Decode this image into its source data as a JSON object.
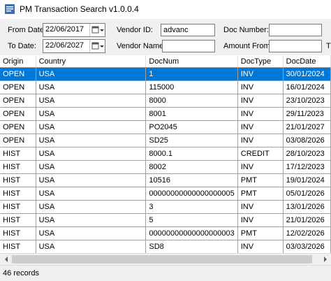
{
  "window": {
    "title": "PM Transaction Search v1.0.0.4"
  },
  "filters": {
    "from_date_label": "From Date:",
    "from_date_value": "22/06/2017",
    "to_date_label": "To Date:",
    "to_date_value": "22/06/2027",
    "vendor_id_label": "Vendor ID:",
    "vendor_id_value": "advanc",
    "vendor_name_label": "Vendor Name:",
    "vendor_name_value": "",
    "doc_number_label": "Doc Number:",
    "doc_number_value": "",
    "amount_from_label": "Amount From:",
    "amount_from_value": "",
    "amount_to_label_partial": "T"
  },
  "grid": {
    "columns": [
      "Origin",
      "Country",
      "DocNum",
      "DocType",
      "DocDate"
    ],
    "rows": [
      [
        "OPEN",
        "USA",
        "1",
        "INV",
        "30/01/2024"
      ],
      [
        "OPEN",
        "USA",
        "115000",
        "INV",
        "16/01/2024"
      ],
      [
        "OPEN",
        "USA",
        "8000",
        "INV",
        "23/10/2023"
      ],
      [
        "OPEN",
        "USA",
        "8001",
        "INV",
        "29/11/2023"
      ],
      [
        "OPEN",
        "USA",
        "PO2045",
        "INV",
        "21/01/2027"
      ],
      [
        "OPEN",
        "USA",
        "SD25",
        "INV",
        "03/08/2026"
      ],
      [
        "HIST",
        "USA",
        "8000.1",
        "CREDIT",
        "28/10/2023"
      ],
      [
        "HIST",
        "USA",
        "8002",
        "INV",
        "17/12/2023"
      ],
      [
        "HIST",
        "USA",
        "10516",
        "PMT",
        "19/01/2024"
      ],
      [
        "HIST",
        "USA",
        "00000000000000000005",
        "PMT",
        "05/01/2026"
      ],
      [
        "HIST",
        "USA",
        "3",
        "INV",
        "13/01/2026"
      ],
      [
        "HIST",
        "USA",
        "5",
        "INV",
        "21/01/2026"
      ],
      [
        "HIST",
        "USA",
        "00000000000000000003",
        "PMT",
        "12/02/2026"
      ],
      [
        "HIST",
        "USA",
        "SD8",
        "INV",
        "03/03/2026"
      ]
    ]
  },
  "status": {
    "text": "46 records"
  },
  "colors": {
    "selection": "#0078d7",
    "window_bg": "#f0f0f0",
    "grid_bg": "#ffffff"
  }
}
